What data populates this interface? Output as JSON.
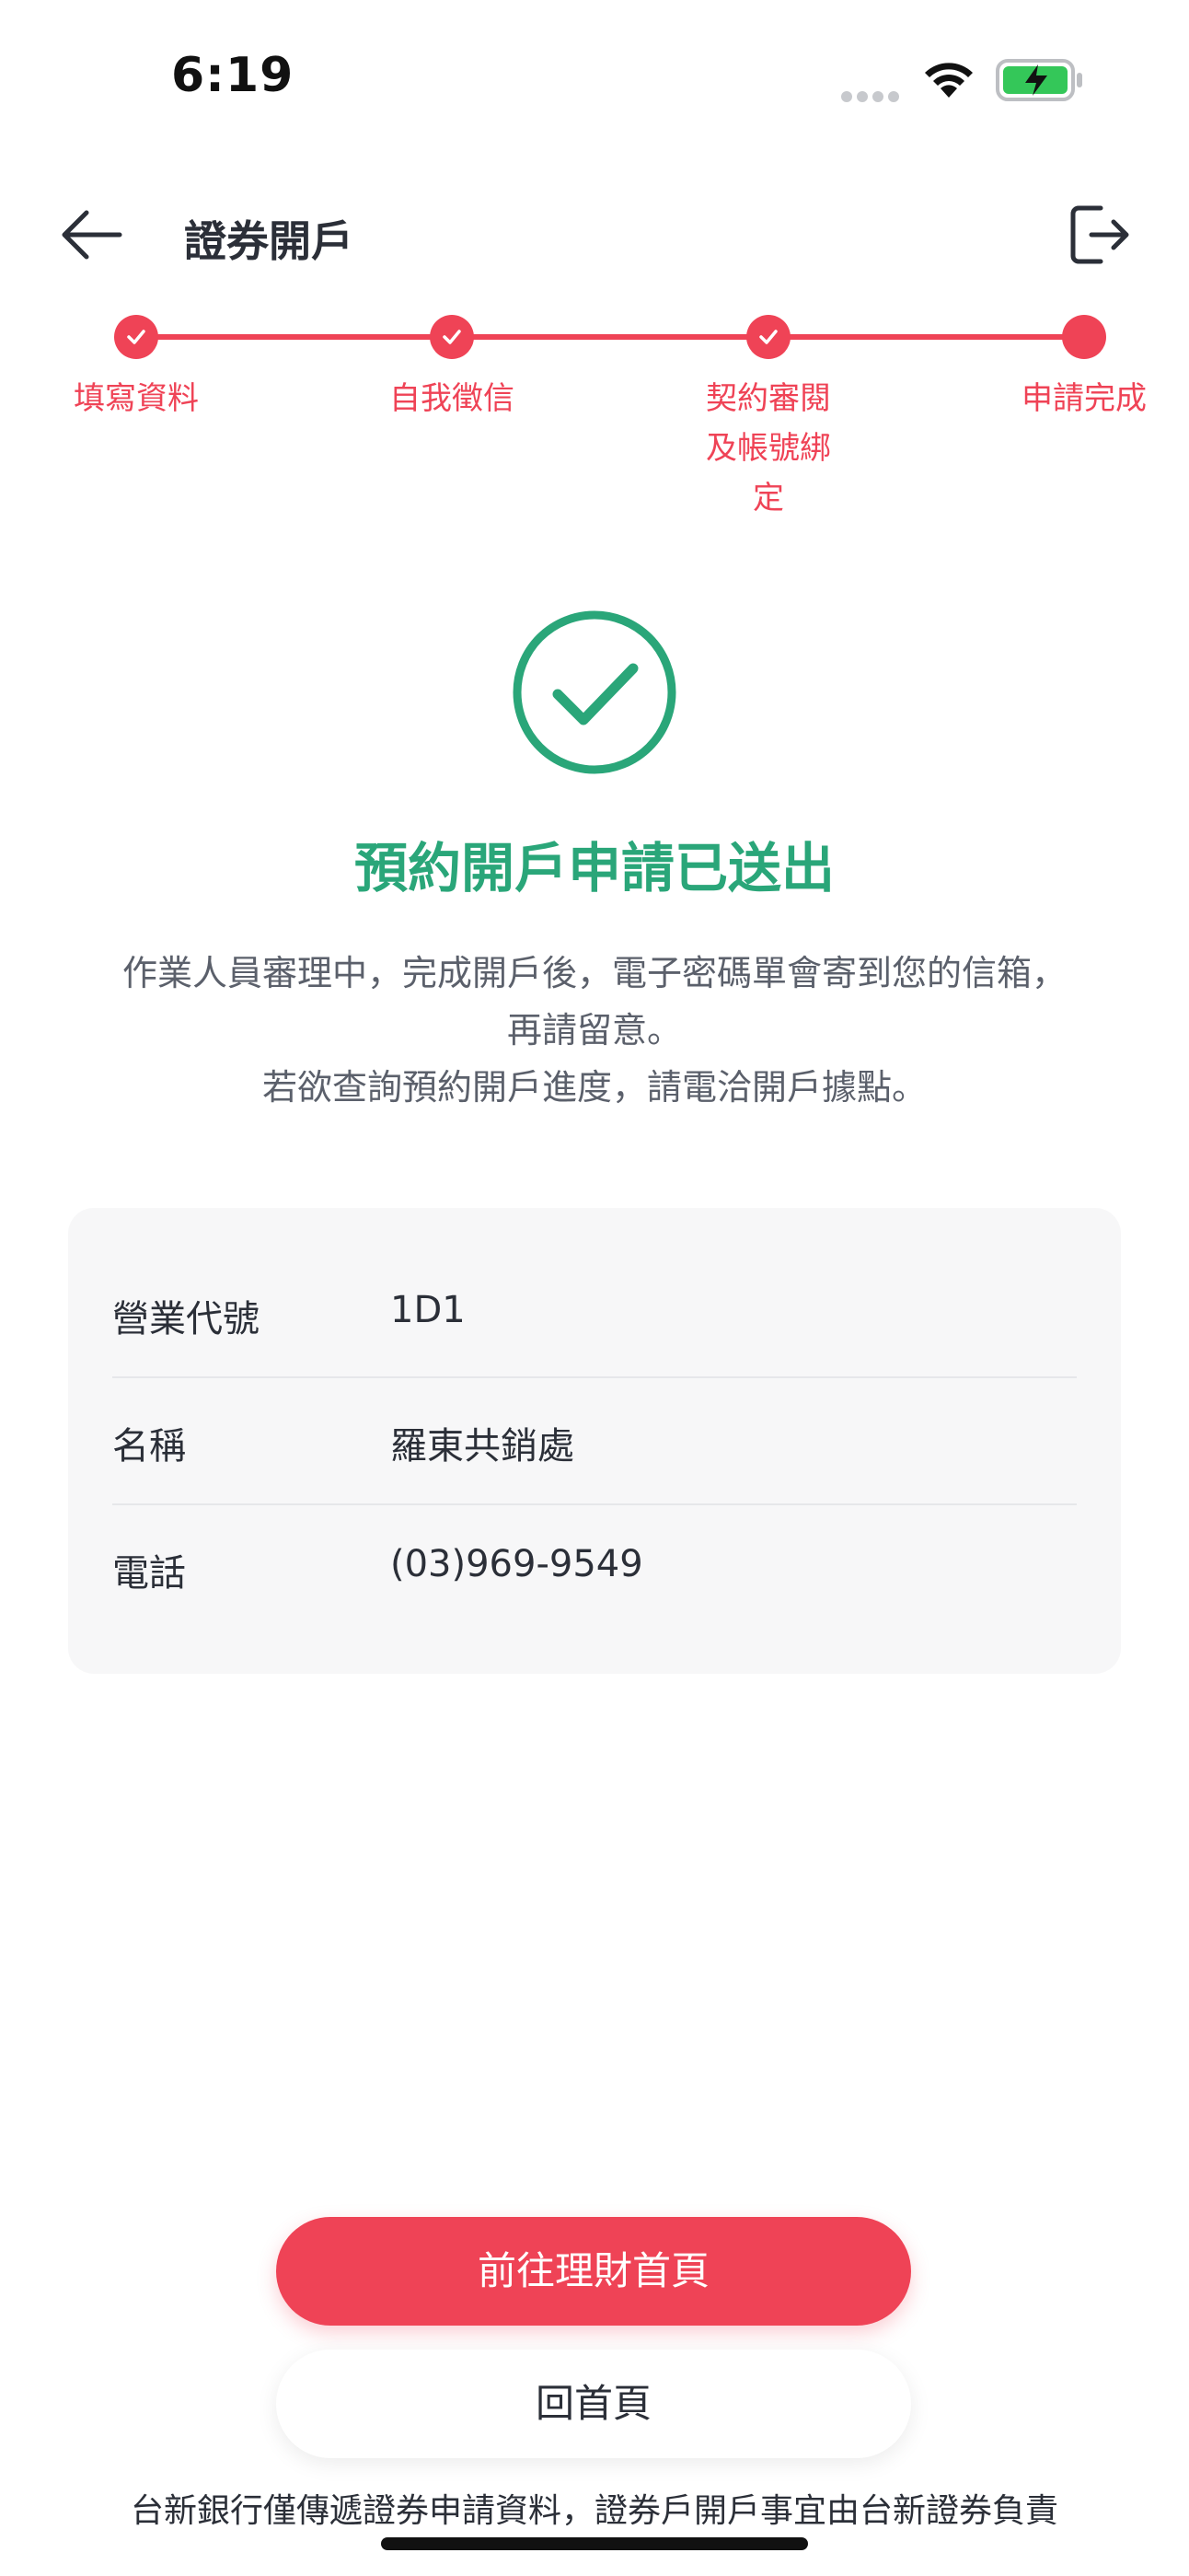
{
  "status_bar": {
    "time": "6:19",
    "battery_color": "#34c759"
  },
  "header": {
    "title": "證券開戶",
    "back_icon": "arrow-left-icon",
    "exit_icon": "logout-icon"
  },
  "stepper": {
    "accent": "#ef4356",
    "steps": [
      {
        "label": "填寫資料",
        "done": true
      },
      {
        "label": "自我徵信",
        "done": true
      },
      {
        "label": "契約審閱及帳號綁定",
        "done": true
      },
      {
        "label": "申請完成",
        "done": false
      }
    ]
  },
  "result": {
    "icon": "check-circle-icon",
    "title": "預約開戶申請已送出",
    "title_color": "#2aa679",
    "desc_line1": "作業人員審理中，完成開戶後，電子密碼單會寄到您的信箱，",
    "desc_line2": "再請留意。",
    "desc_line3": "若欲查詢預約開戶進度，請電洽開戶據點。"
  },
  "branch_info": {
    "rows": [
      {
        "label": "營業代號",
        "value": "1D1"
      },
      {
        "label": "名稱",
        "value": "羅東共銷處"
      },
      {
        "label": "電話",
        "value": "(03)969-9549"
      }
    ]
  },
  "actions": {
    "primary_label": "前往理財首頁",
    "secondary_label": "回首頁"
  },
  "footer": {
    "note": "台新銀行僅傳遞證券申請資料，證券戶開戶事宜由台新證券負責"
  }
}
